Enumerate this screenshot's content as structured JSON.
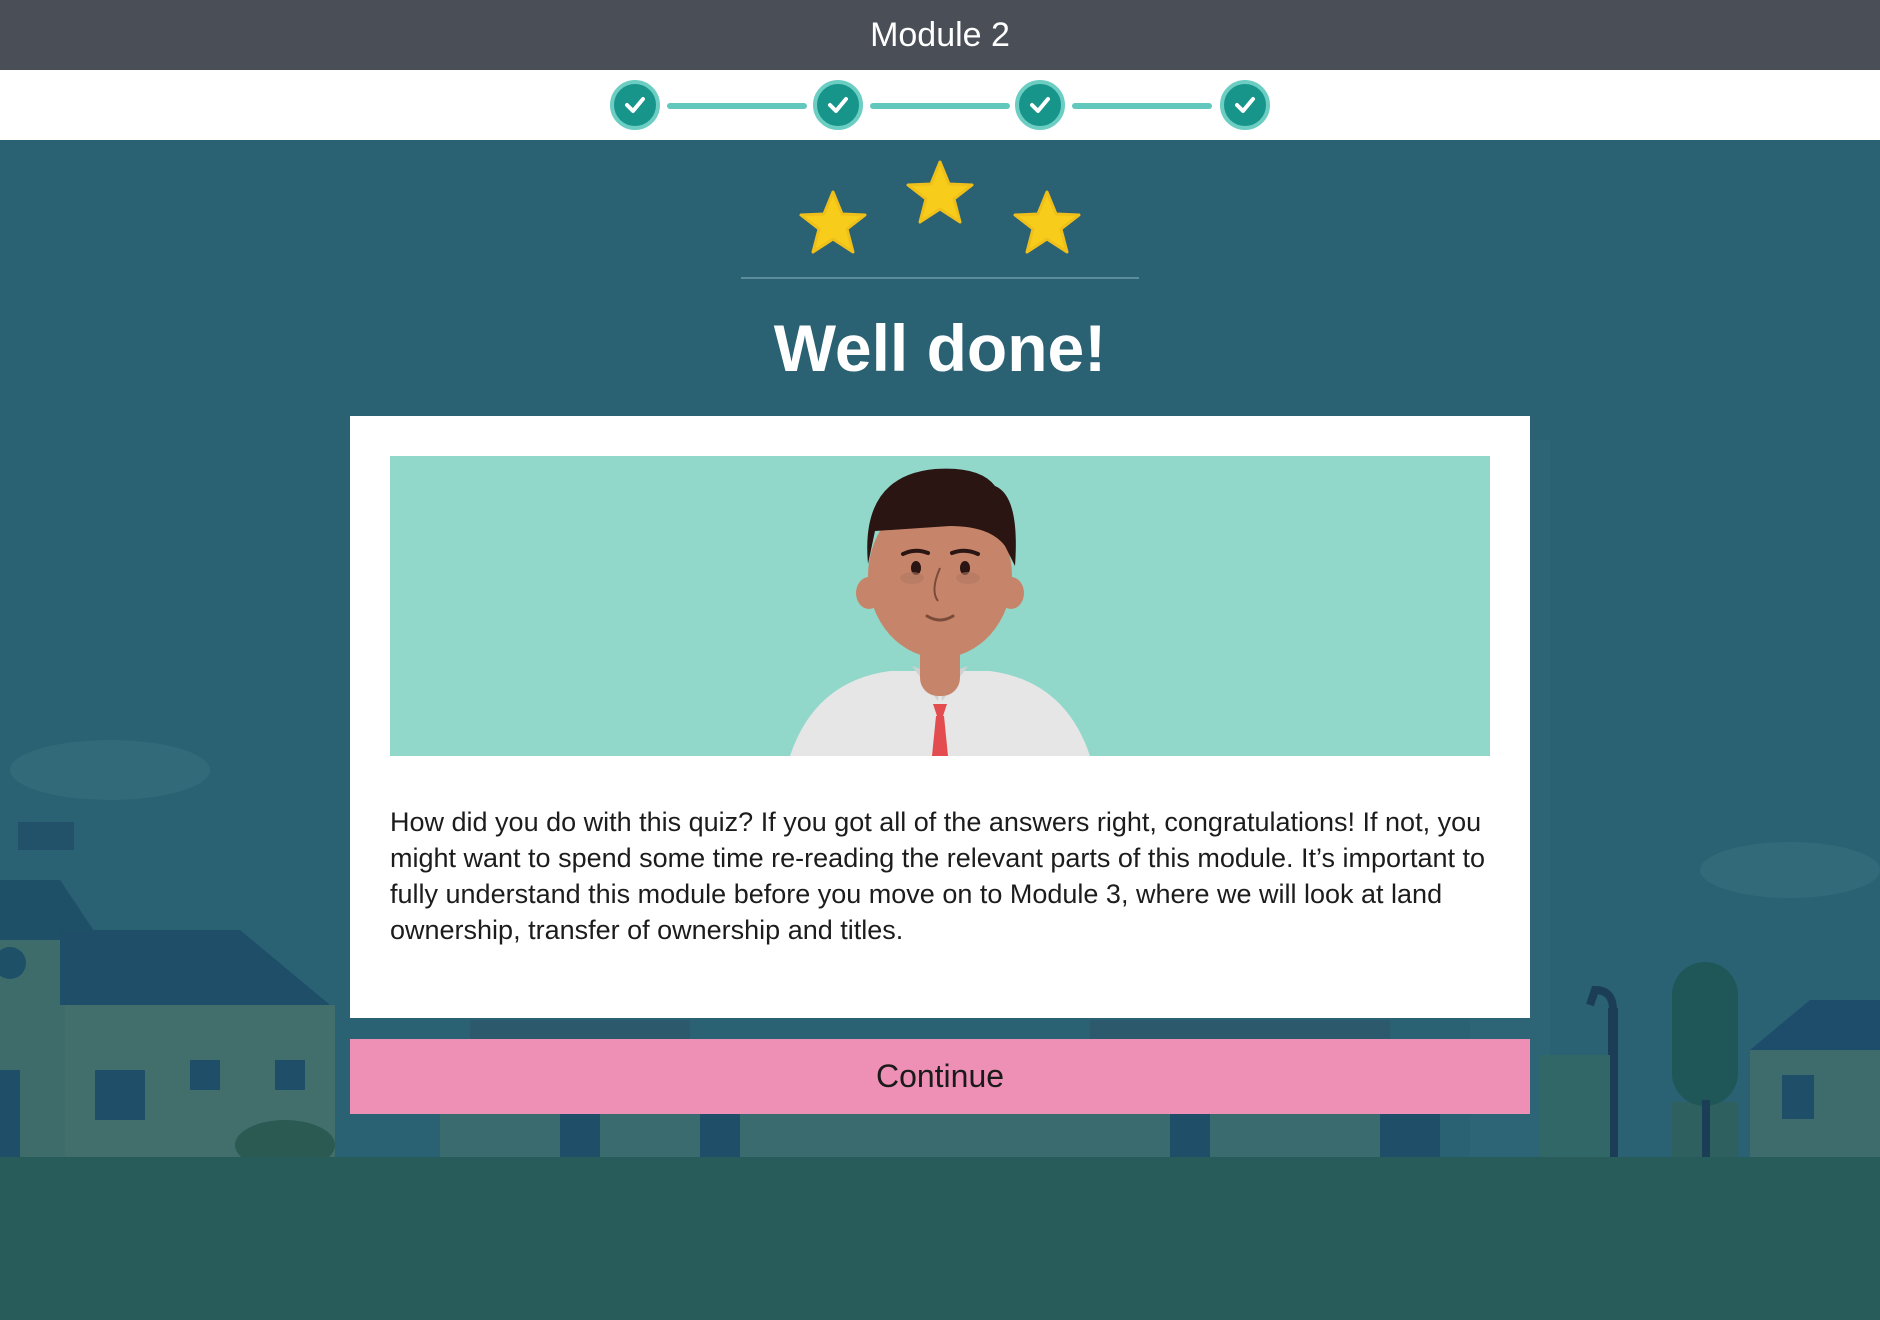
{
  "header": {
    "title": "Module 2"
  },
  "progress": {
    "steps": [
      {
        "status": "complete",
        "icon": "check-icon"
      },
      {
        "status": "complete",
        "icon": "check-icon"
      },
      {
        "status": "complete",
        "icon": "check-icon"
      },
      {
        "status": "complete",
        "icon": "check-icon"
      }
    ],
    "colors": {
      "step_fill": "#17958a",
      "connector": "#62c7bd"
    }
  },
  "result": {
    "stars_earned": 3,
    "stars_total": 3,
    "star_color": "#f8cc1b"
  },
  "heading": "Well done!",
  "message": "How did you do with this quiz? If you got all of the answers right, congratulations! If not, you might want to spend some time re-reading the relevant parts of this module. It’s important to fully understand this module before you move on to Module 3, where we will look at land ownership, transfer of ownership and titles.",
  "continue_label": "Continue",
  "colors": {
    "topbar": "#4a4e57",
    "background": "#2a6173",
    "illustration_bg": "#91d8ca",
    "continue_button": "#ee90b6"
  }
}
